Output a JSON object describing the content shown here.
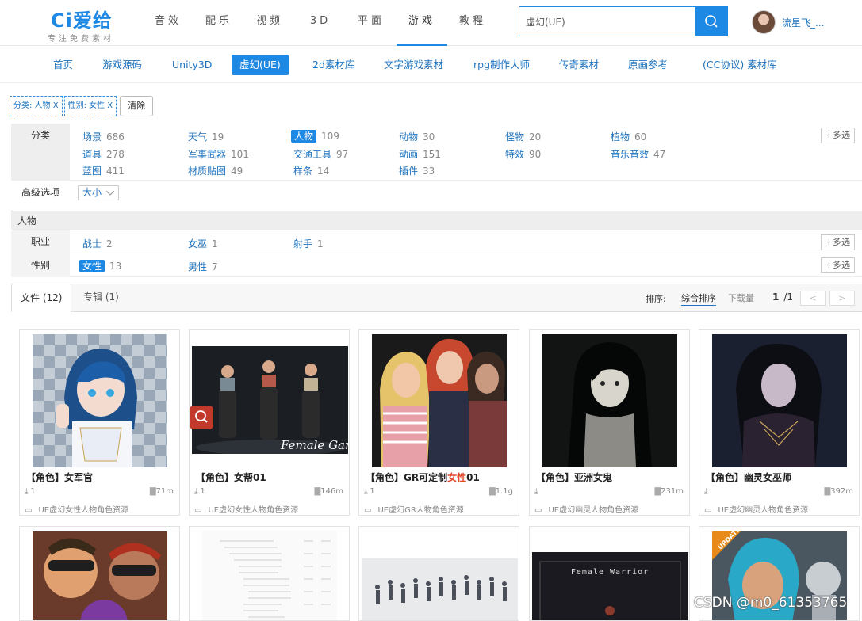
{
  "header": {
    "logo_text": "Ci爱给",
    "logo_tagline": "专注免费素材",
    "nav": [
      "音效",
      "配乐",
      "视频",
      "3D",
      "平面",
      "游戏",
      "教程"
    ],
    "nav_active_index": 5,
    "search_value": "虚幻(UE)",
    "user_name": "流星飞_..."
  },
  "subnav": {
    "items": [
      "首页",
      "游戏源码",
      "Unity3D",
      "虚幻(UE)",
      "2d素材库",
      "文字游戏素材",
      "rpg制作大师",
      "传奇素材",
      "原画参考",
      "(CC协议) 素材库"
    ],
    "active_index": 3
  },
  "active_filters": {
    "chips": [
      "分类: 人物 X",
      "性别: 女性 X"
    ],
    "clear_label": "清除"
  },
  "filters": {
    "category": {
      "label": "分类",
      "options": [
        {
          "name": "场景",
          "count": "686"
        },
        {
          "name": "天气",
          "count": "19"
        },
        {
          "name": "人物",
          "count": "109"
        },
        {
          "name": "动物",
          "count": "30"
        },
        {
          "name": "怪物",
          "count": "20"
        },
        {
          "name": "植物",
          "count": "60"
        },
        {
          "name": "道具",
          "count": "278"
        },
        {
          "name": "军事武器",
          "count": "101"
        },
        {
          "name": "交通工具",
          "count": "97"
        },
        {
          "name": "动画",
          "count": "151"
        },
        {
          "name": "特效",
          "count": "90"
        },
        {
          "name": "音乐音效",
          "count": "47"
        },
        {
          "name": "蓝图",
          "count": "411"
        },
        {
          "name": "材质贴图",
          "count": "49"
        },
        {
          "name": "样条",
          "count": "14"
        },
        {
          "name": "插件",
          "count": "33"
        }
      ],
      "selected_index": 2,
      "multi_label": "+多选"
    },
    "advanced": {
      "label": "高级选项",
      "dropdown": "大小"
    },
    "section_title": "人物",
    "profession": {
      "label": "职业",
      "options": [
        {
          "name": "战士",
          "count": "2"
        },
        {
          "name": "女巫",
          "count": "1"
        },
        {
          "name": "射手",
          "count": "1"
        }
      ],
      "multi_label": "+多选"
    },
    "gender": {
      "label": "性别",
      "options": [
        {
          "name": "女性",
          "count": "13"
        },
        {
          "name": "男性",
          "count": "7"
        }
      ],
      "selected_index": 0,
      "multi_label": "+多选"
    }
  },
  "tabs": {
    "files": "文件 (12)",
    "albums": "专辑 (1)",
    "sort_label": "排序:",
    "sort_options": [
      "综合排序",
      "下载量"
    ],
    "page_current": "1",
    "page_sep": "/",
    "page_total": "1",
    "prev": "<",
    "next": ">"
  },
  "cards": [
    {
      "title_pre": "【角色】女军官",
      "title_hl": "",
      "title_post": "",
      "downloads": "1",
      "size": "71m",
      "category": "UE虚幻女性人物角色资源"
    },
    {
      "title_pre": "【角色】女帮01",
      "title_hl": "",
      "title_post": "",
      "downloads": "1",
      "size": "146m",
      "category": "UE虚幻女性人物角色资源"
    },
    {
      "title_pre": "【角色】GR可定制",
      "title_hl": "女性",
      "title_post": "01",
      "downloads": "1",
      "size": "1.1g",
      "category": "UE虚幻GR人物角色资源"
    },
    {
      "title_pre": "【角色】亚洲女鬼",
      "title_hl": "",
      "title_post": "",
      "downloads": "",
      "size": "231m",
      "category": "UE虚幻幽灵人物角色资源"
    },
    {
      "title_pre": "【角色】幽灵女巫师",
      "title_hl": "",
      "title_post": "",
      "downloads": "",
      "size": "392m",
      "category": "UE虚幻幽灵人物角色资源"
    }
  ],
  "thumb_labels": {
    "female_gang": "Female Gang",
    "female_warrior": "Female Warrior",
    "update": "UPDATE"
  },
  "watermark": "CSDN @m0_61353765",
  "colors": {
    "brand": "#1e88e5",
    "link": "#1e73be",
    "highlight": "#e34a2b"
  }
}
